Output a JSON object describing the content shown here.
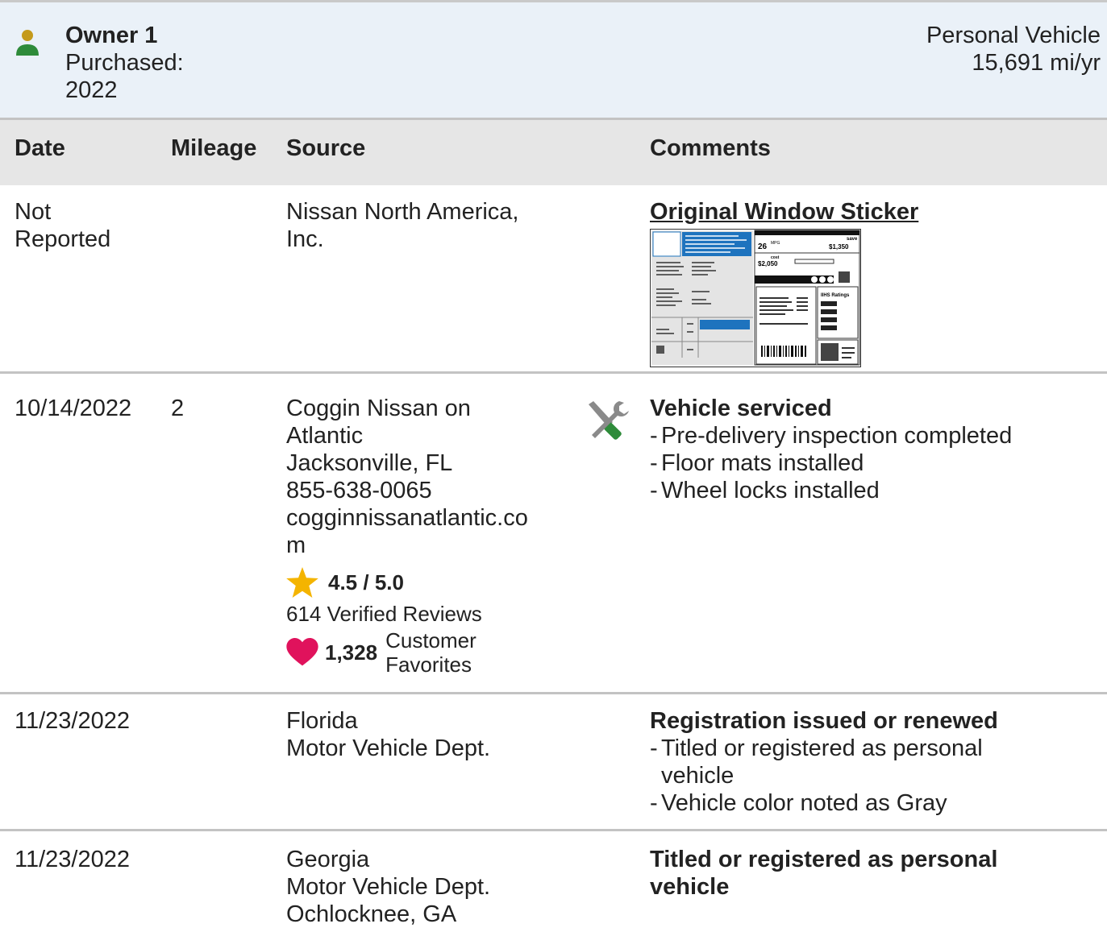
{
  "owner": {
    "name": "Owner 1",
    "purchased_label": "Purchased:",
    "purchased_year": "2022",
    "vehicle_type": "Personal Vehicle",
    "mileage_per_year": "15,691 mi/yr",
    "icon": "person-icon",
    "icon_colors": {
      "head": "#c49a1c",
      "body": "#2e8b3a"
    }
  },
  "table": {
    "headers": {
      "date": "Date",
      "mileage": "Mileage",
      "source": "Source",
      "comments": "Comments"
    },
    "rows": [
      {
        "date_line1": "Not",
        "date_line2": "Reported",
        "mileage": "",
        "source_line1": "Nissan North America,",
        "source_line2": "Inc.",
        "comment_title": "Original Window Sticker",
        "sticker": {
          "fuel_economy": "26",
          "mpg_label": "MPG",
          "save_label": "save",
          "save_amount": "$1,350",
          "cost_label": "cost",
          "cost_amount": "$2,050",
          "ratings_label": "IIHS Ratings"
        }
      },
      {
        "date": "10/14/2022",
        "mileage": "2",
        "source_lines": [
          "Coggin Nissan on",
          "Atlantic",
          "Jacksonville, FL",
          "855-638-0065",
          "cogginnissanatlantic.co",
          "m"
        ],
        "rating": "4.5 / 5.0",
        "reviews": "614 Verified Reviews",
        "favorites_count": "1,328",
        "favorites_label_1": "Customer",
        "favorites_label_2": "Favorites",
        "comment_title": "Vehicle serviced",
        "comment_items": [
          "Pre-delivery inspection completed",
          "Floor mats installed",
          "Wheel locks installed"
        ],
        "icon": "wrench-screwdriver-icon"
      },
      {
        "date": "11/23/2022",
        "mileage": "",
        "source_lines": [
          "Florida",
          "Motor Vehicle Dept."
        ],
        "comment_title": "Registration issued or renewed",
        "comment_items": [
          "Titled or registered as personal vehicle",
          "Vehicle color noted as Gray"
        ]
      },
      {
        "date": "11/23/2022",
        "mileage": "",
        "source_lines": [
          "Georgia",
          "Motor Vehicle Dept.",
          "Ochlocknee, GA"
        ],
        "comment_title_1": "Titled or registered as personal",
        "comment_title_2": "vehicle"
      }
    ]
  },
  "colors": {
    "owner_bg": "#eaf1f8",
    "header_bg": "#e6e6e6",
    "star": "#f4b400",
    "heart": "#e0125c",
    "sticker_blue": "#1e73be"
  }
}
